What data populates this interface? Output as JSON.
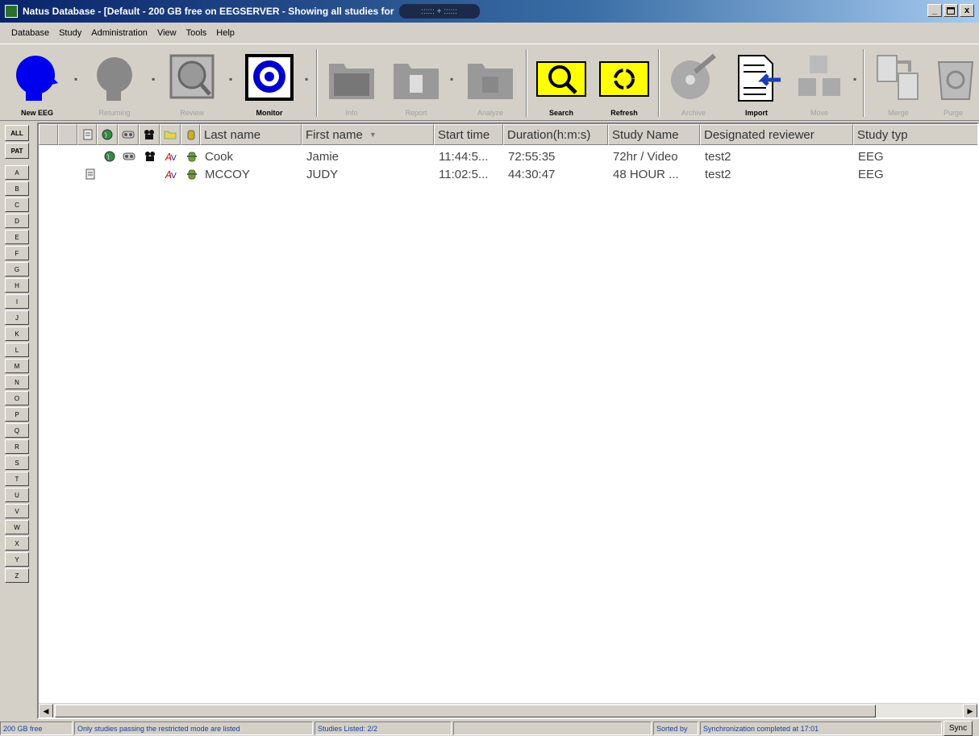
{
  "window": {
    "title": "Natus Database - [Default - 200 GB free on EEGSERVER - Showing all studies for",
    "title_overlay": "::::::  +  ::::::",
    "buttons": [
      "_",
      " ",
      "x"
    ]
  },
  "menu": [
    "Database",
    "Study",
    "Administration",
    "View",
    "Tools",
    "Help"
  ],
  "toolbar": {
    "new_eeg": "New EEG",
    "returning": "Returning",
    "review": "Review",
    "monitor": "Monitor",
    "info": "Info",
    "report": "Report",
    "analyze": "Analyze",
    "search": "Search",
    "refresh": "Refresh",
    "archive": "Archive",
    "import": "Import",
    "move": "Move",
    "merge": "Merge",
    "purge": "Purge"
  },
  "letters": [
    "ALL",
    "PAT",
    "A",
    "B",
    "C",
    "D",
    "E",
    "F",
    "G",
    "H",
    "I",
    "J",
    "K",
    "L",
    "M",
    "N",
    "O",
    "P",
    "Q",
    "R",
    "S",
    "T",
    "U",
    "V",
    "W",
    "X",
    "Y",
    "Z"
  ],
  "columns": {
    "last_name": "Last name",
    "first_name": "First name",
    "sort_indicator": "▼",
    "start_time": "Start time",
    "duration": "Duration(h:m:s)",
    "study_name": "Study Name",
    "reviewer": "Designated reviewer",
    "study_type": "Study typ"
  },
  "rows": [
    {
      "last": "Cook",
      "first": "Jamie",
      "start": "11:44:5...",
      "duration": "72:55:35",
      "study": "72hr / Video",
      "reviewer": "test2",
      "type": "EEG"
    },
    {
      "last": "MCCOY",
      "first": "JUDY",
      "start": "11:02:5...",
      "duration": "44:30:47",
      "study": "48 HOUR ...",
      "reviewer": "test2",
      "type": "EEG"
    }
  ],
  "status": {
    "free": "200 GB free",
    "restricted": "Only studies passing the restricted mode are listed",
    "listed": "Studies Listed: 2/2",
    "sorted": "Sorted by",
    "sync_msg": "Synchronization completed at 17:01",
    "sync_btn": "Sync"
  },
  "colors": {
    "title_bar": "#0a246a",
    "search_folder": "#ffff00",
    "new_eeg_head": "#0000ff",
    "status_text": "#1a3f9a"
  }
}
